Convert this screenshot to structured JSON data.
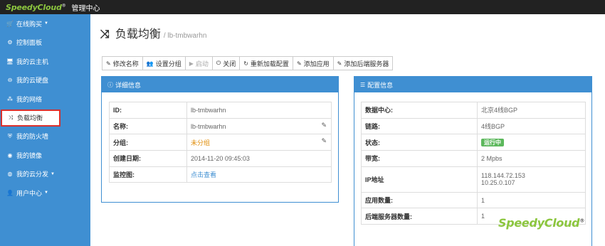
{
  "topbar": {
    "logo": "SpeedyCloud",
    "logo_mark": "®",
    "title": "管理中心"
  },
  "sidebar": {
    "items": [
      {
        "icon": "cart-icon",
        "glyph": "🛒",
        "label": "在线购买",
        "caret": true
      },
      {
        "icon": "dashboard-icon",
        "glyph": "⚙",
        "label": "控制面板"
      },
      {
        "icon": "monitor-icon",
        "glyph": "🖥",
        "label": "我的云主机"
      },
      {
        "icon": "disk-icon",
        "glyph": "⊖",
        "label": "我的云硬盘"
      },
      {
        "icon": "network-icon",
        "glyph": "⁂",
        "label": "我的网络"
      },
      {
        "icon": "shuffle-icon",
        "glyph": "⤨",
        "label": "负载均衡",
        "active": true
      },
      {
        "icon": "shield-icon",
        "glyph": "⛨",
        "label": "我的防火墙"
      },
      {
        "icon": "image-icon",
        "glyph": "◉",
        "label": "我的镜像"
      },
      {
        "icon": "globe-icon",
        "glyph": "◍",
        "label": "我的云分发",
        "caret": true
      },
      {
        "icon": "user-icon",
        "glyph": "👤",
        "label": "用户中心",
        "caret": true
      }
    ]
  },
  "header": {
    "title": "负载均衡",
    "subtitle": "/ lb-tmbwarhn"
  },
  "toolbar": {
    "buttons": [
      {
        "icon": "edit-icon",
        "glyph": "✎",
        "label": "修改名称"
      },
      {
        "icon": "group-icon",
        "glyph": "👥",
        "label": "设置分组"
      },
      {
        "icon": "play-icon",
        "glyph": "▶",
        "label": "启动",
        "disabled": true
      },
      {
        "icon": "power-icon",
        "glyph": "⏻",
        "label": "关闭"
      },
      {
        "icon": "reload-icon",
        "glyph": "↻",
        "label": "重新加载配置"
      },
      {
        "icon": "edit-icon",
        "glyph": "✎",
        "label": "添加应用"
      },
      {
        "icon": "edit-icon",
        "glyph": "✎",
        "label": "添加后端服务器"
      }
    ]
  },
  "detail": {
    "heading": "详细信息",
    "rows": [
      {
        "key": "ID:",
        "value": "lb-tmbwarhn"
      },
      {
        "key": "名称:",
        "value": "lb-tmbwarhn",
        "editable": true
      },
      {
        "key": "分组:",
        "value": "未分组",
        "editable": true,
        "style": "warn"
      },
      {
        "key": "创建日期:",
        "value": "2014-11-20 09:45:03"
      },
      {
        "key": "监控图:",
        "value": "点击查看",
        "style": "link"
      }
    ]
  },
  "config": {
    "heading": "配置信息",
    "rows": [
      {
        "key": "数据中心:",
        "value": "北京4线BGP"
      },
      {
        "key": "链路:",
        "value": "4线BGP"
      },
      {
        "key": "状态:",
        "value": "运行中",
        "style": "badge"
      },
      {
        "key": "带宽:",
        "value": "2 Mpbs"
      },
      {
        "key": "IP地址",
        "value": "118.144.72.153",
        "value2": "10.25.0.107"
      },
      {
        "key": "应用数量:",
        "value": "1"
      },
      {
        "key": "后端服务器数量:",
        "value": "1"
      }
    ]
  },
  "footer_brand": {
    "text": "SpeedyCloud",
    "mark": "®"
  },
  "colors": {
    "primary": "#3f8fd2",
    "topbar": "#222222",
    "brand_green": "#8cc63f",
    "active_border": "#d9302c",
    "run_green": "#5cb85c"
  }
}
